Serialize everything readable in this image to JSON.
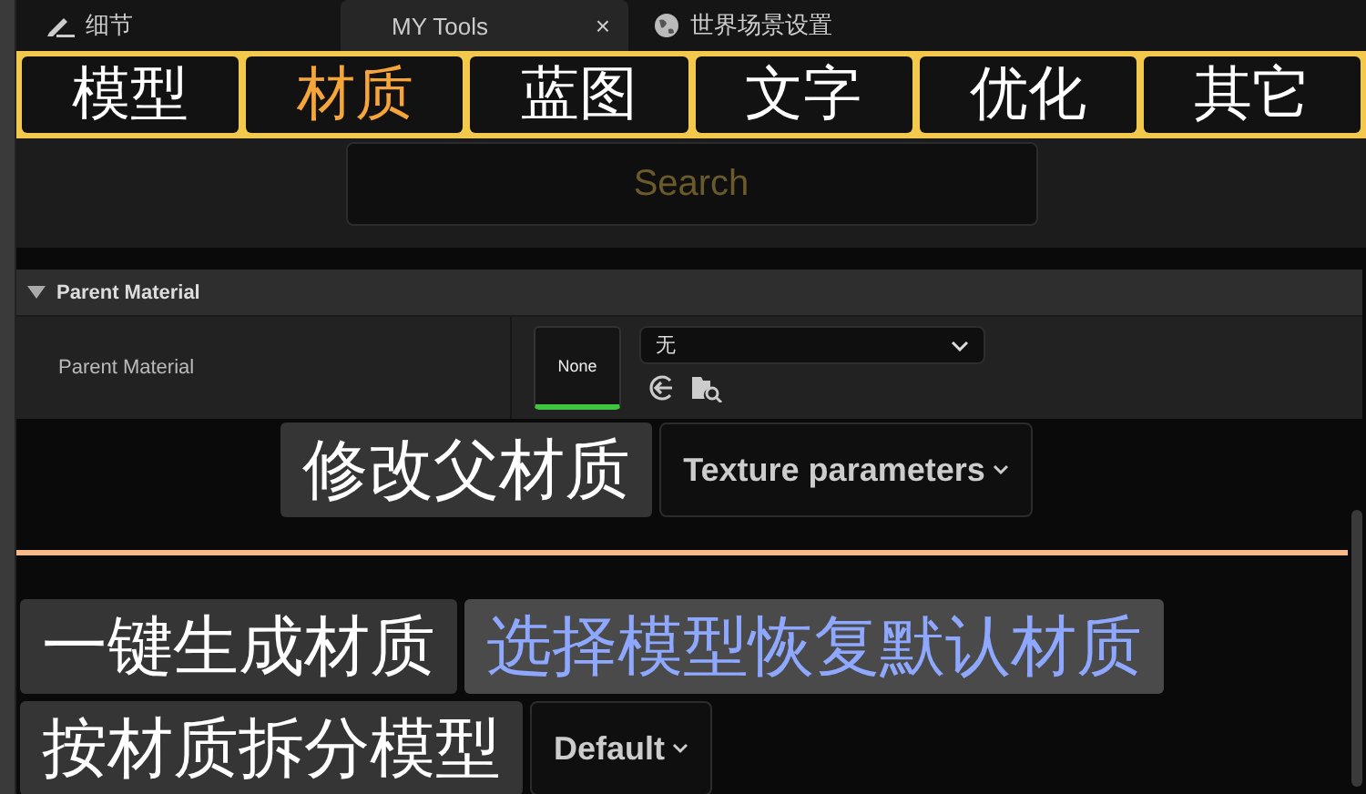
{
  "panel_tabs": [
    {
      "label": "细节",
      "kind": "details",
      "selected": false,
      "closable": false
    },
    {
      "label": "MY Tools",
      "kind": "tool",
      "selected": true,
      "closable": true,
      "close": "×"
    },
    {
      "label": "世界场景设置",
      "kind": "world",
      "selected": false,
      "closable": false
    }
  ],
  "categories": [
    {
      "label": "模型",
      "selected": false
    },
    {
      "label": "材质",
      "selected": true
    },
    {
      "label": "蓝图",
      "selected": false
    },
    {
      "label": "文字",
      "selected": false
    },
    {
      "label": "优化",
      "selected": false
    },
    {
      "label": "其它",
      "selected": false
    }
  ],
  "search": {
    "placeholder": "Search"
  },
  "section": {
    "title": "Parent Material",
    "expanded": true,
    "property": {
      "label": "Parent Material",
      "thumbnail": "None",
      "value": "无"
    }
  },
  "action_rows": [
    {
      "centered": true,
      "items": [
        {
          "kind": "button",
          "label": "修改父材质",
          "highlighted": false
        },
        {
          "kind": "dropdown",
          "label": "Texture parameters"
        }
      ]
    },
    {
      "divider": true,
      "centered": false,
      "items": [
        {
          "kind": "button",
          "label": "一键生成材质",
          "highlighted": false
        },
        {
          "kind": "button",
          "label": "选择模型恢复默认材质",
          "highlighted": true
        }
      ]
    },
    {
      "centered": false,
      "items": [
        {
          "kind": "button",
          "label": "按材质拆分模型",
          "highlighted": false
        },
        {
          "kind": "dropdown",
          "label": "Default"
        }
      ]
    }
  ]
}
